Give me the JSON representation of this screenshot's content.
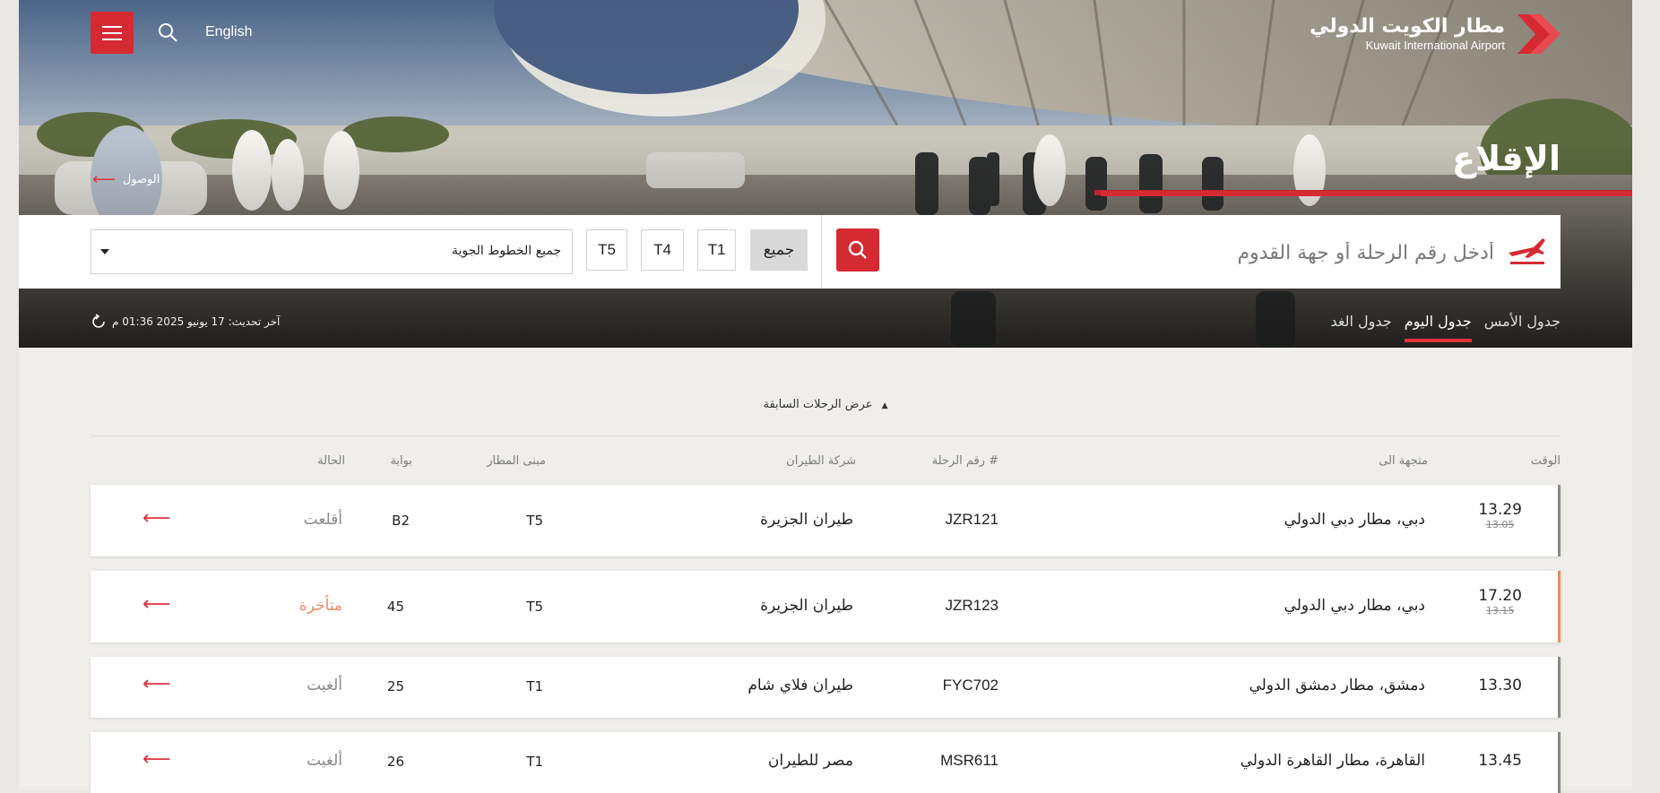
{
  "header": {
    "language": "English",
    "logo_ar": "مطار الكويت الدولي",
    "logo_en": "Kuwait International Airport",
    "page_title": "الإقلاع",
    "arrivals_link": "الوصول"
  },
  "search": {
    "placeholder": "أدخل رقم الرحلة أو جهة القدوم",
    "terminals": [
      "جميع",
      "T1",
      "T4",
      "T5"
    ],
    "airline_select": "جميع الخطوط الجوية"
  },
  "tabs": {
    "yesterday": "جدول الأمس",
    "today": "جدول اليوم",
    "tomorrow": "جدول الغد"
  },
  "last_update": "آخر تحديث: 17 يونيو 2025 01:36 م",
  "previous_flights": "عرض الرحلات السابقة",
  "columns": {
    "time": "الوقت",
    "destination": "متجهة الى",
    "flight_no": "رقم الرحلة #",
    "airline": "شركة الطيران",
    "terminal": "مبنى المطار",
    "gate": "بوابة",
    "status": "الحالة"
  },
  "flights": [
    {
      "time": "13.29",
      "old_time": "13.05",
      "destination": "دبي، مطار دبي الدولي",
      "flight": "JZR121",
      "airline": "طيران الجزيرة",
      "terminal": "T5",
      "gate": "B2",
      "status": "أقلعت"
    },
    {
      "time": "17.20",
      "old_time": "13.15",
      "destination": "دبي، مطار دبي الدولي",
      "flight": "JZR123",
      "airline": "طيران الجزيرة",
      "terminal": "T5",
      "gate": "45",
      "status": "متأخرة"
    },
    {
      "time": "13.30",
      "old_time": "",
      "destination": "دمشق، مطار دمشق الدولي",
      "flight": "FYC702",
      "airline": "طيران فلاي شام",
      "terminal": "T1",
      "gate": "25",
      "status": "ألغيت"
    },
    {
      "time": "13.45",
      "old_time": "",
      "destination": "القاهرة، مطار القاهرة الدولي",
      "flight": "MSR611",
      "airline": "مصر للطيران",
      "terminal": "T1",
      "gate": "26",
      "status": "ألغيت"
    }
  ],
  "colors": {
    "accent": "#d62a33",
    "delayed": "#f08a62",
    "muted": "#8a8a8a"
  },
  "icons": [
    "menu-icon",
    "search-icon",
    "plane-icon",
    "refresh-icon",
    "arrow-left-icon",
    "chevron-up-icon",
    "caret-down-icon"
  ]
}
